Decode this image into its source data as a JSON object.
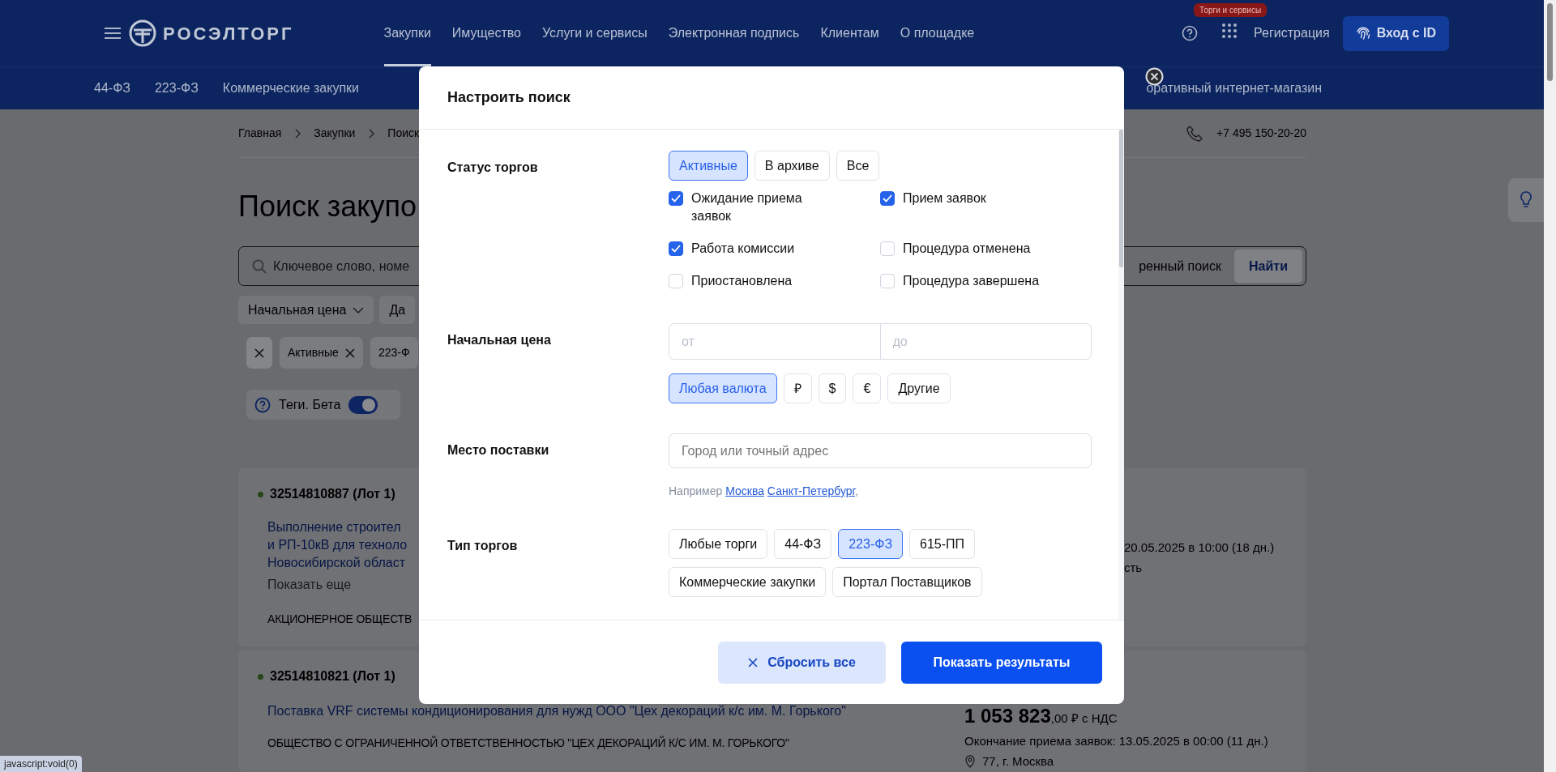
{
  "header": {
    "logo": "РОСЭЛТОРГ",
    "nav": [
      {
        "label": "Закупки",
        "selected": true
      },
      {
        "label": "Имущество",
        "selected": false
      },
      {
        "label": "Услуги и сервисы",
        "selected": false
      },
      {
        "label": "Электронная подпись",
        "selected": false
      },
      {
        "label": "Клиентам",
        "selected": false
      },
      {
        "label": "О площадке",
        "selected": false
      }
    ],
    "badge": "Торги и сервисы",
    "register": "Регистрация",
    "login": "Вход с ID"
  },
  "subnav": {
    "items": [
      "44-ФЗ",
      "223-ФЗ",
      "Коммерческие закупки"
    ],
    "cut_item": "оративный интернет-магазин"
  },
  "breadcrumbs": [
    "Главная",
    "Закупки",
    "Поиск"
  ],
  "phone": "+7 495 150-20-20",
  "page_title": "Поиск закупо",
  "search": {
    "placeholder": "Ключевое слово, номе",
    "advanced": "ренный поиск",
    "button": "Найти"
  },
  "filters": [
    {
      "label": "Начальная цена",
      "dropdown": true
    },
    {
      "label": "Да",
      "dropdown": false
    }
  ],
  "chips": [
    {
      "label": "Активные",
      "removable": true
    },
    {
      "label": "223-Ф",
      "removable": false
    }
  ],
  "tags_toggle": {
    "label": "Теги. Бета",
    "on": true
  },
  "results": [
    {
      "number": "32514810887 (Лот 1)",
      "title_lines": [
        "Выполнение строител",
        "и РП-10кВ для техноло",
        "Новосибирской област"
      ],
      "show_more": "Показать еще",
      "customer": "АКЦИОНЕРНОЕ ОБЩЕСТВ",
      "deadline": "20.05.2025 в 10:00 (18 дн.)",
      "region": "сть",
      "pin": false
    },
    {
      "number": "32514810821 (Лот 1)",
      "title_lines": [
        "Поставка VRF системы кондиционирования для нужд ООО \"Цех декораций к/с им. М. Горького\""
      ],
      "customer": "ОБЩЕСТВО С ОГРАНИЧЕННОЙ ОТВЕТСТВЕННОСТЬЮ \"ЦЕХ ДЕКОРАЦИЙ К/С ИМ. М. ГОРЬКОГО\"",
      "price": "1 053 823",
      "price_cents": ",00",
      "price_note": "₽ с НДС",
      "deadline": "Окончание приема заявок: 13.05.2025 в 00:00 (11 дн.)",
      "region": "77, г. Москва",
      "pin": true
    }
  ],
  "status_bar": "javascript:void(0)",
  "dialog": {
    "title": "Настроить поиск",
    "sections": [
      {
        "kind": "status",
        "label": "Статус торгов",
        "options": [
          {
            "label": "Активные",
            "selected": true
          },
          {
            "label": "В архиве",
            "selected": false
          },
          {
            "label": "Все",
            "selected": false
          }
        ],
        "checkboxes": [
          {
            "label": "Ожидание приема заявок",
            "checked": true
          },
          {
            "label": "Прием заявок",
            "checked": true
          },
          {
            "label": "Работа комиссии",
            "checked": true
          },
          {
            "label": "Процедура отменена",
            "checked": false
          },
          {
            "label": "Приостановлена",
            "checked": false
          },
          {
            "label": "Процедура завершена",
            "checked": false
          }
        ]
      },
      {
        "kind": "price",
        "label": "Начальная цена",
        "from_placeholder": "от",
        "to_placeholder": "до",
        "options": [
          {
            "label": "Любая валюта",
            "selected": true
          },
          {
            "label": "₽",
            "selected": false
          },
          {
            "label": "$",
            "selected": false
          },
          {
            "label": "€",
            "selected": false
          },
          {
            "label": "Другие",
            "selected": false
          }
        ]
      },
      {
        "kind": "place",
        "label": "Место поставки",
        "placeholder": "Город или точный адрес",
        "hint": "Например",
        "examples": [
          "Москва",
          "Санкт-Петербург"
        ],
        "hint_tail": ","
      },
      {
        "kind": "type",
        "label": "Тип торгов",
        "options": [
          {
            "label": "Любые торги",
            "selected": false
          },
          {
            "label": "44-ФЗ",
            "selected": false
          },
          {
            "label": "223-ФЗ",
            "selected": true
          },
          {
            "label": "615-ПП",
            "selected": false
          },
          {
            "label": "Коммерческие закупки",
            "selected": false
          },
          {
            "label": "Портал Поставщиков",
            "selected": false
          }
        ]
      }
    ],
    "reset": "Сбросить все",
    "submit": "Показать результаты"
  }
}
